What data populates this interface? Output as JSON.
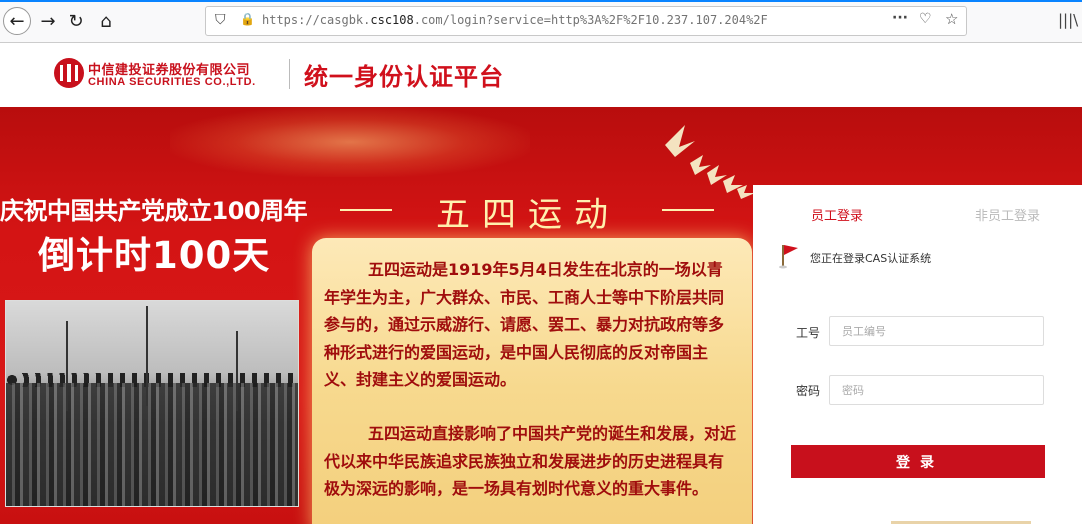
{
  "browser": {
    "url_main": "https://casgbk.",
    "url_host": "csc108",
    "url_rest": ".com/login?service=http%3A%2F%2F10.237.107.204%2F",
    "icons": [
      "back-icon",
      "forward-icon",
      "reload-icon",
      "home-icon",
      "shield-icon",
      "lock-icon",
      "more-icon",
      "pocket-icon",
      "star-icon",
      "library-icon"
    ]
  },
  "header": {
    "company_cn": "中信建投证券股份有限公司",
    "company_en": "CHINA SECURITIES CO.,LTD.",
    "platform_title": "统一身份认证平台"
  },
  "banner": {
    "celebrate": "庆祝中国共产党成立100周年",
    "countdown": "倒计时100天",
    "may4_title": "五四运动",
    "para1": "五四运动是1919年5月4日发生在北京的一场以青年学生为主，广大群众、市民、工商人士等中下阶层共同参与的，通过示威游行、请愿、罢工、暴力对抗政府等多种形式进行的爱国运动，是中国人民彻底的反对帝国主义、封建主义的爱国运动。",
    "para2": "五四运动直接影响了中国共产党的诞生和发展，对近代以来中华民族追求民族独立和发展进步的历史进程具有极为深远的影响，是一场具有划时代意义的重大事件。"
  },
  "login": {
    "tab_staff": "员工登录",
    "tab_nonstaff": "非员工登录",
    "cas_tip": "您正在登录CAS认证系统",
    "id_label": "工号",
    "id_placeholder": "员工编号",
    "pw_label": "密码",
    "pw_placeholder": "密码",
    "submit": "登录"
  },
  "colors": {
    "brand_red": "#c8101c",
    "banner_red": "#d41414",
    "scroll_gold": "#f7d98e"
  }
}
